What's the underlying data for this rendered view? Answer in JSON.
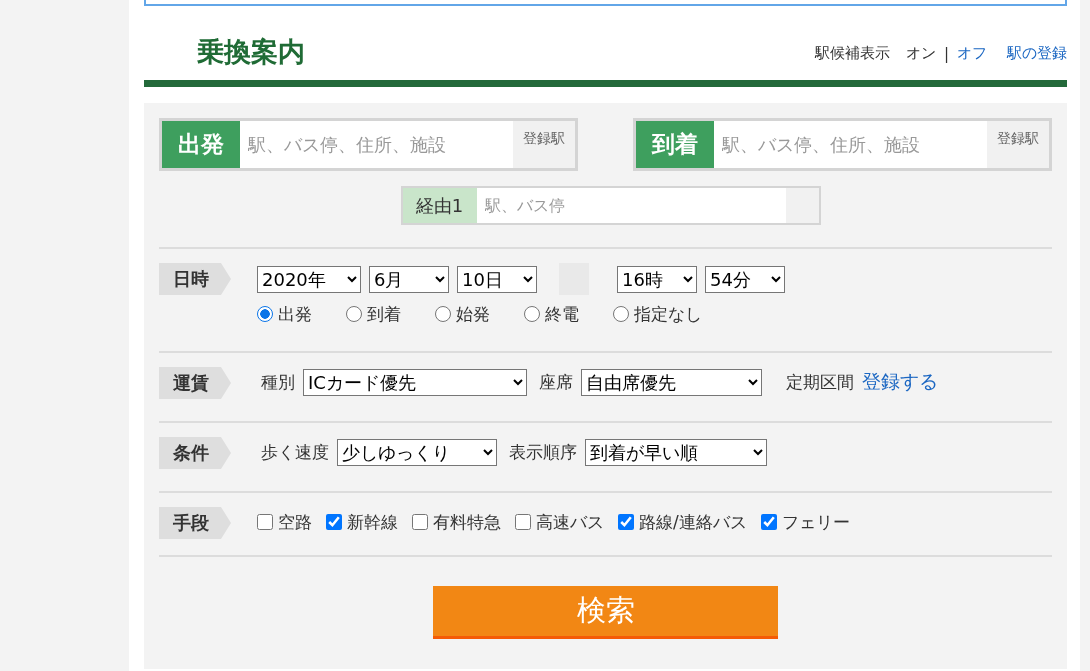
{
  "header": {
    "title": "乗換案内",
    "candidate_display": {
      "label": "駅候補表示",
      "separator": "|",
      "options": [
        {
          "label": "オン",
          "selected": true
        },
        {
          "label": "オフ",
          "selected": false
        }
      ]
    },
    "register_link": "駅の登録"
  },
  "stations": [
    {
      "label": "出発",
      "placeholder": "駅、バス停、住所、施設",
      "button": "登録駅"
    },
    {
      "label": "到着",
      "placeholder": "駅、バス停、住所、施設",
      "button": "登録駅"
    }
  ],
  "via": {
    "label": "経由1",
    "placeholder": "駅、バス停"
  },
  "sections": [
    {
      "kind": "datetime",
      "label": "日時",
      "date_selects": [
        "2020年",
        "6月",
        "10日"
      ],
      "time_selects": [
        "16時",
        "54分"
      ],
      "radios": [
        {
          "label": "出発",
          "selected": true
        },
        {
          "label": "到着",
          "selected": false
        },
        {
          "label": "始発",
          "selected": false
        },
        {
          "label": "終電",
          "selected": false
        },
        {
          "label": "指定なし",
          "selected": false
        }
      ]
    },
    {
      "kind": "selects",
      "label": "運賃",
      "items": [
        {
          "label": "種別",
          "value": "ICカード優先"
        },
        {
          "label": "座席",
          "value": "自由席優先"
        }
      ],
      "extra": {
        "label": "定期区間",
        "link": "登録する"
      }
    },
    {
      "kind": "selects",
      "label": "条件",
      "items": [
        {
          "label": "歩く速度",
          "value": "少しゆっくり"
        },
        {
          "label": "表示順序",
          "value": "到着が早い順"
        }
      ]
    },
    {
      "kind": "checks",
      "label": "手段",
      "checkboxes": [
        {
          "label": "空路",
          "checked": false
        },
        {
          "label": "新幹線",
          "checked": true
        },
        {
          "label": "有料特急",
          "checked": false
        },
        {
          "label": "高速バス",
          "checked": false
        },
        {
          "label": "路線/連絡バス",
          "checked": true
        },
        {
          "label": "フェリー",
          "checked": true
        }
      ]
    }
  ],
  "search_button": "検索"
}
